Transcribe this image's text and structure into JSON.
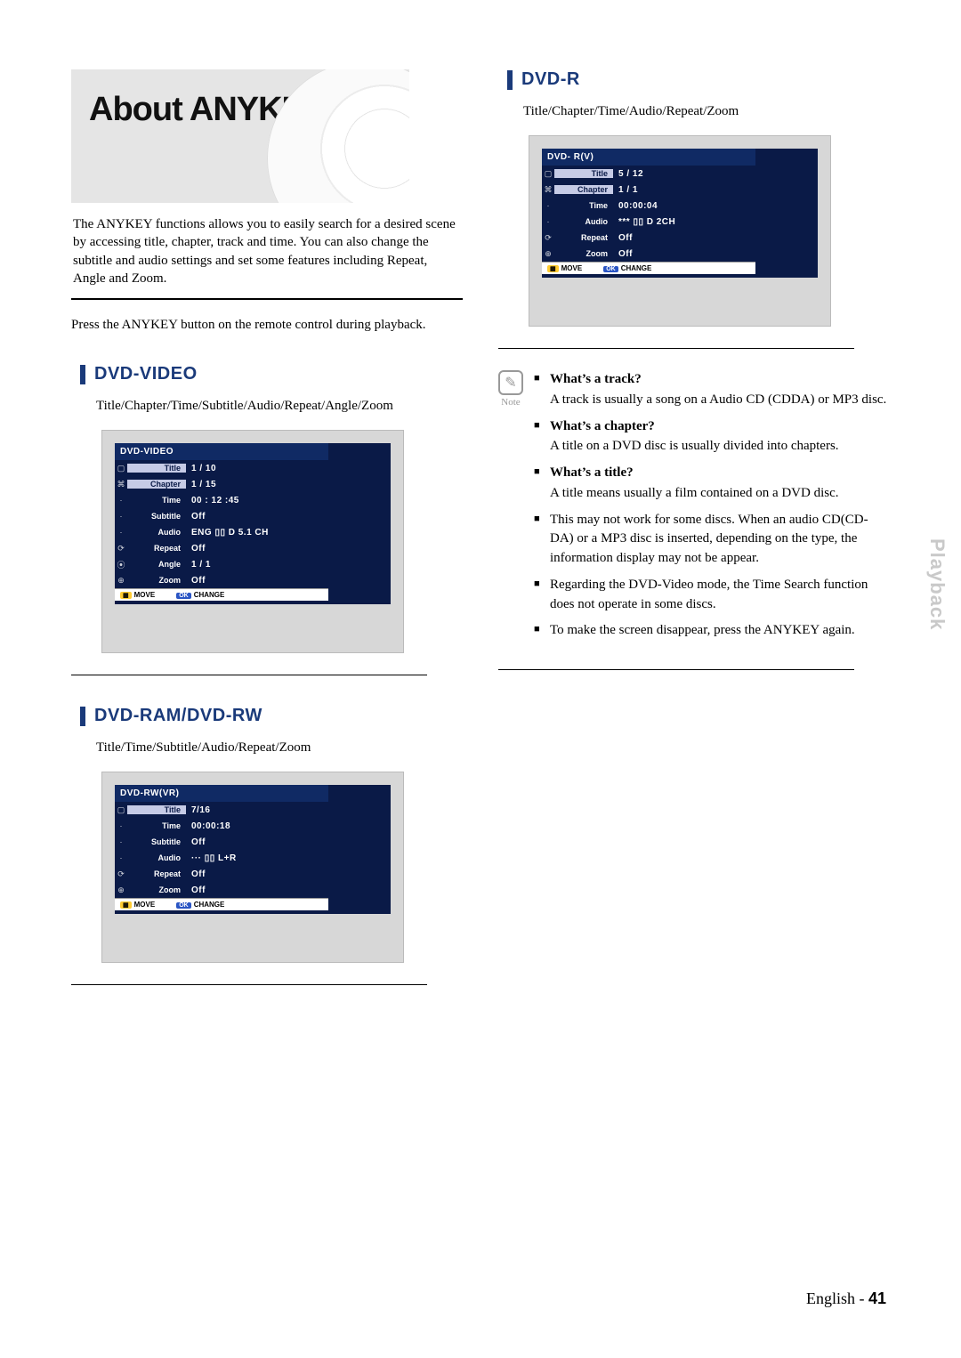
{
  "hero": {
    "title": "About ANYKEY"
  },
  "intro": "The ANYKEY functions allows you to easily search for a desired scene by accessing title, chapter, track and time. You can also change the subtitle and audio settings and set some features including Repeat, Angle and Zoom.",
  "press": "Press the ANYKEY button on the remote control during playback.",
  "sections": {
    "dvd_video": {
      "heading": "DVD-VIDEO",
      "subline": "Title/Chapter/Time/Subtitle/Audio/Repeat/Angle/Zoom",
      "osd": {
        "header": "DVD-VIDEO",
        "rows": [
          {
            "icon": "▢",
            "label": "Title",
            "highlight": true,
            "value": "1 / 10"
          },
          {
            "icon": "⌘",
            "label": "Chapter",
            "highlight": true,
            "value": "1 / 15"
          },
          {
            "icon": "·",
            "label": "Time",
            "highlight": false,
            "value": "00 : 12 :45"
          },
          {
            "icon": "·",
            "label": "Subtitle",
            "highlight": false,
            "value": "Off"
          },
          {
            "icon": "·",
            "label": "Audio",
            "highlight": false,
            "value": "ENG ▯▯ D 5.1 CH"
          },
          {
            "icon": "⟳",
            "label": "Repeat",
            "highlight": false,
            "value": "Off"
          },
          {
            "icon": "⦿",
            "label": "Angle",
            "highlight": false,
            "value": "1 / 1"
          },
          {
            "icon": "⊕",
            "label": "Zoom",
            "highlight": false,
            "value": "Off"
          }
        ],
        "footer": {
          "move": "MOVE",
          "change": "CHANGE"
        }
      }
    },
    "dvd_ram_rw": {
      "heading": "DVD-RAM/DVD-RW",
      "subline": "Title/Time/Subtitle/Audio/Repeat/Zoom",
      "osd": {
        "header": "DVD-RW(VR)",
        "rows": [
          {
            "icon": "▢",
            "label": "Title",
            "highlight": true,
            "value": "7/16"
          },
          {
            "icon": "·",
            "label": "Time",
            "highlight": false,
            "value": "00:00:18"
          },
          {
            "icon": "·",
            "label": "Subtitle",
            "highlight": false,
            "value": "Off"
          },
          {
            "icon": "·",
            "label": "Audio",
            "highlight": false,
            "value": "···  ▯▯ L+R"
          },
          {
            "icon": "⟳",
            "label": "Repeat",
            "highlight": false,
            "value": "Off"
          },
          {
            "icon": "⊕",
            "label": "Zoom",
            "highlight": false,
            "value": "Off"
          }
        ],
        "footer": {
          "move": "MOVE",
          "change": "CHANGE"
        }
      }
    },
    "dvd_r": {
      "heading": "DVD-R",
      "subline": "Title/Chapter/Time/Audio/Repeat/Zoom",
      "osd": {
        "header": "DVD- R(V)",
        "rows": [
          {
            "icon": "▢",
            "label": "Title",
            "highlight": true,
            "value": "5 / 12"
          },
          {
            "icon": "⌘",
            "label": "Chapter",
            "highlight": true,
            "value": "1 / 1"
          },
          {
            "icon": "·",
            "label": "Time",
            "highlight": false,
            "value": "00:00:04"
          },
          {
            "icon": "·",
            "label": "Audio",
            "highlight": false,
            "value": "*** ▯▯ D 2CH"
          },
          {
            "icon": "⟳",
            "label": "Repeat",
            "highlight": false,
            "value": "Off"
          },
          {
            "icon": "⊕",
            "label": "Zoom",
            "highlight": false,
            "value": "Off"
          }
        ],
        "footer": {
          "move": "MOVE",
          "change": "CHANGE"
        }
      }
    }
  },
  "note_label": "Note",
  "notes": [
    {
      "q": "What’s a track?",
      "a": "A track is usually a song on a Audio CD (CDDA) or MP3 disc."
    },
    {
      "q": "What’s a chapter?",
      "a": "A title on a DVD disc is usually divided into chapters."
    },
    {
      "q": "What’s a title?",
      "a": "A title means usually a film contained on a DVD disc."
    },
    {
      "q": "",
      "a": "This may not work for some discs. When an audio CD(CD-DA) or a MP3 disc is inserted, depending on the type, the information display may not be appear."
    },
    {
      "q": "",
      "a": "Regarding the DVD-Video mode, the Time Search function does not operate in some discs."
    },
    {
      "q": "",
      "a": "To make the screen disappear, press the ANYKEY again."
    }
  ],
  "sidetab": "Playback",
  "footer": {
    "lang": "English - ",
    "page": "41"
  }
}
